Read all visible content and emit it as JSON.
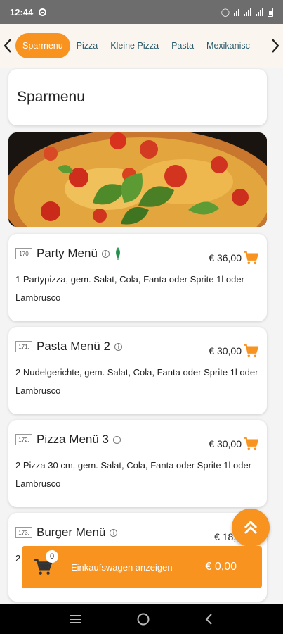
{
  "status_bar": {
    "time": "12:44"
  },
  "categories": {
    "tabs": [
      {
        "label": "Sparmenu",
        "active": true
      },
      {
        "label": "Pizza",
        "active": false
      },
      {
        "label": "Kleine Pizza",
        "active": false
      },
      {
        "label": "Pasta",
        "active": false
      },
      {
        "label": "Mexikanisc",
        "active": false
      }
    ]
  },
  "section": {
    "title": "Sparmenu"
  },
  "menu_items": [
    {
      "number": "170",
      "name": "Party Menü",
      "price": "€ 36,00",
      "description": "1 Partypizza, gem. Salat, Cola, Fanta oder Sprite 1l oder Lambrusco",
      "vegetarian_icon": "leaf-icon"
    },
    {
      "number": "171.",
      "name": "Pasta Menü 2",
      "price": "€ 30,00",
      "description": "2 Nudelgerichte, gem. Salat, Cola, Fanta oder Sprite 1l oder Lambrusco"
    },
    {
      "number": "172.",
      "name": "Pizza Menü 3",
      "price": "€ 30,00",
      "description": "2 Pizza 30 cm, gem. Salat, Cola, Fanta oder Sprite 1l oder Lambrusco"
    },
    {
      "number": "173.",
      "name": "Burger Menü",
      "price": "€ 18,0",
      "description": "2"
    }
  ],
  "cart": {
    "count": "0",
    "label": "Einkaufswagen anzeigen",
    "total": "€ 0,00"
  },
  "colors": {
    "accent": "#f7931e",
    "tab_text": "#2a5a6a"
  }
}
